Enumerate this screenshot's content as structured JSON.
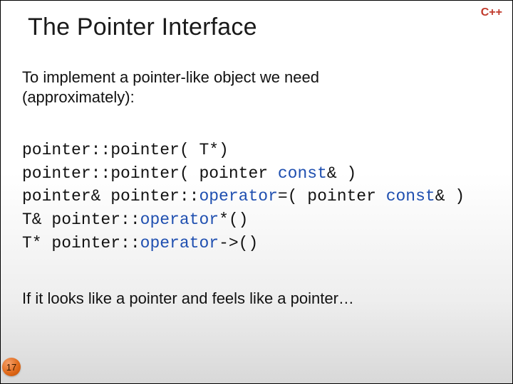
{
  "badge": "C++",
  "title": "The Pointer Interface",
  "intro_line1": "To implement a pointer-like object we need",
  "intro_line2": "(approximately):",
  "code": {
    "l1_a": "pointer::pointer( T*)",
    "l2_a": "pointer::pointer( pointer ",
    "l2_kw": "const",
    "l2_b": "& )",
    "l3_a": "pointer& pointer::",
    "l3_kw": "operator",
    "l3_b": "=( pointer ",
    "l3_kw2": "const",
    "l3_c": "& )",
    "l4_a": "T& pointer::",
    "l4_kw": "operator",
    "l4_b": "*()",
    "l5_a": "T* pointer::",
    "l5_kw": "operator",
    "l5_b": "->()"
  },
  "outro": "If it looks like a pointer and feels like a pointer…",
  "page_number": "17"
}
